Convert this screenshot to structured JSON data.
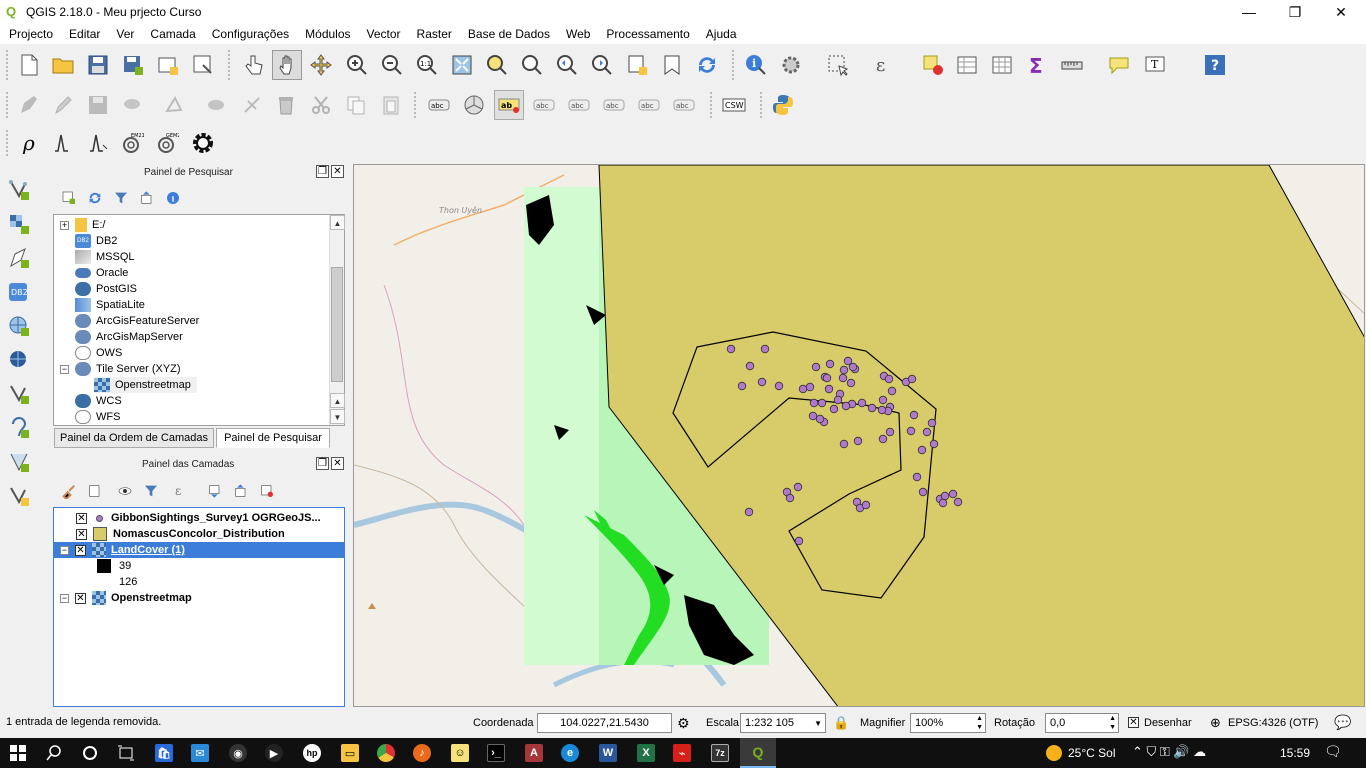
{
  "window": {
    "title": "QGIS 2.18.0 - Meu prjecto Curso",
    "minimize": "—",
    "maximize": "❐",
    "close": "✕"
  },
  "menu": [
    "Projecto",
    "Editar",
    "Ver",
    "Camada",
    "Configurações",
    "Módulos",
    "Vector",
    "Raster",
    "Base de Dados",
    "Web",
    "Processamento",
    "Ajuda"
  ],
  "browser_panel": {
    "title": "Painel de Pesquisar",
    "items": [
      {
        "label": "E:/",
        "icon": "folder-icon"
      },
      {
        "label": "DB2",
        "icon": "db2-icon"
      },
      {
        "label": "MSSQL",
        "icon": "mssql-icon"
      },
      {
        "label": "Oracle",
        "icon": "oracle-icon"
      },
      {
        "label": "PostGIS",
        "icon": "postgis-icon"
      },
      {
        "label": "SpatiaLite",
        "icon": "spatialite-icon"
      },
      {
        "label": "ArcGisFeatureServer",
        "icon": "arcgis-icon"
      },
      {
        "label": "ArcGisMapServer",
        "icon": "arcgis-icon"
      },
      {
        "label": "OWS",
        "icon": "ows-icon"
      },
      {
        "label": "Tile Server (XYZ)",
        "icon": "xyz-icon"
      },
      {
        "label": "Openstreetmap",
        "icon": "tile-layer-icon"
      },
      {
        "label": "WCS",
        "icon": "wcs-icon"
      },
      {
        "label": "WFS",
        "icon": "wfs-icon"
      }
    ]
  },
  "tabs": {
    "layer_order": "Painel da Ordem de Camadas",
    "browser": "Painel de Pesquisar"
  },
  "layers_panel": {
    "title": "Painel das Camadas",
    "layers": [
      {
        "name": "GibbonSightings_Survey1 OGRGeoJS...",
        "checked": "✕"
      },
      {
        "name": "NomascusConcolor_Distribution",
        "checked": "✕"
      },
      {
        "name": "LandCover (1)",
        "checked": "✕",
        "selected": true
      },
      {
        "name": "Openstreetmap",
        "checked": "✕"
      }
    ],
    "legend": [
      {
        "label": "39",
        "color": "#000000"
      },
      {
        "label": "126",
        "color": "#ffffff"
      }
    ]
  },
  "map": {
    "place_label": "Thon Uyên",
    "colors": {
      "distribution_fill": "#d8cc6a",
      "landcover_light": "#b8f5b8",
      "landcover_bright": "#22dd22",
      "points": "#b079cc"
    }
  },
  "status": {
    "message": "1 entrada de legenda removida.",
    "coord_label": "Coordenada",
    "coord_value": "104.0227,21.5430",
    "scale_label": "Escala",
    "scale_value": "1:232 105",
    "magnifier_label": "Magnifier",
    "magnifier_value": "100%",
    "rotation_label": "Rotação",
    "rotation_value": "0,0",
    "render_label": "Desenhar",
    "crs": "EPSG:4326 (OTF)"
  },
  "taskbar": {
    "weather": "25°C  Sol",
    "time": "15:59"
  }
}
